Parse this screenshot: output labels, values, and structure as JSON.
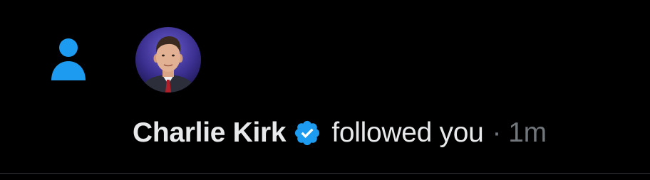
{
  "notification": {
    "type_icon": "person-icon",
    "user_name": "Charlie Kirk",
    "verified_icon": "verified-badge-icon",
    "action": "followed you",
    "separator": "·",
    "time": "1m"
  },
  "colors": {
    "background": "#000000",
    "accent": "#1d9bf0",
    "primary_text": "#e7e9ea",
    "secondary_text": "#71767b",
    "divider": "#2f3336"
  }
}
